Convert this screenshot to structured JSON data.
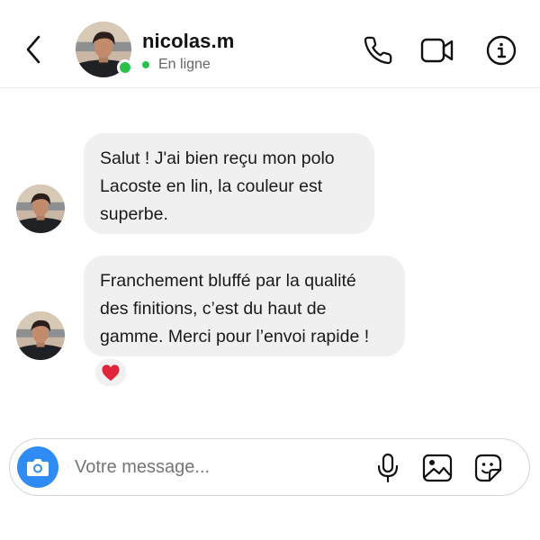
{
  "header": {
    "username": "nicolas.m",
    "status": "En ligne",
    "icons": [
      "chevron-left-icon",
      "phone-icon",
      "video-camera-icon",
      "info-icon"
    ]
  },
  "messages": [
    {
      "sender": "nicolas.m",
      "text": "Salut ! J'ai bien reçu mon polo Lacoste en lin, la couleur est superbe."
    },
    {
      "sender": "nicolas.m",
      "text": "Franchement bluffé par la qualité des finitions, c’est du haut de gamme. Merci pour l’envoi rapide !",
      "reaction": "❤️"
    }
  ],
  "composer": {
    "placeholder": "Votre message...",
    "icons": [
      "camera-icon",
      "microphone-icon",
      "image-icon",
      "sticker-icon"
    ]
  },
  "colors": {
    "accent": "#2f8cf4",
    "online": "#2bc04a",
    "bubble": "#f0f0f1",
    "reaction": "#e0243a"
  }
}
